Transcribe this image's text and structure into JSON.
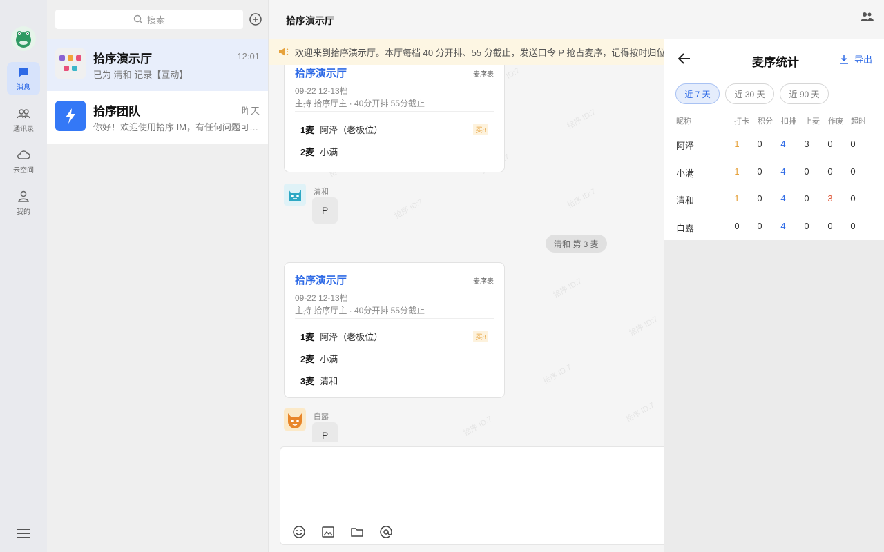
{
  "nav": {
    "items": [
      {
        "label": "消息",
        "icon": "chat-icon",
        "active": true
      },
      {
        "label": "通讯录",
        "icon": "contacts-icon",
        "active": false
      },
      {
        "label": "云空间",
        "icon": "cloud-icon",
        "active": false
      },
      {
        "label": "我的",
        "icon": "user-icon",
        "active": false
      }
    ]
  },
  "search": {
    "placeholder": "搜索"
  },
  "conversations": [
    {
      "name": "拾序演示厅",
      "time": "12:01",
      "preview": "已为 清和 记录【互动】",
      "active": true
    },
    {
      "name": "拾序团队",
      "time": "昨天",
      "preview": "你好！欢迎使用拾序 IM，有任何问题可随时联系我们",
      "active": false
    }
  ],
  "chat": {
    "title": "拾序演示厅",
    "notice": "欢迎来到拾序演示厅。本厅每档 40 分开排、55 分截止，发送口令 P 抢占麦序，记得按时归位。",
    "card1": {
      "title": "拾序演示厅",
      "tag": "麦序表",
      "date": "09-22 12-13档",
      "host": "主持 拾序厅主 · 40分开排 55分截止",
      "rows": [
        {
          "slot": "1麦",
          "name": "阿泽（老板位）",
          "badge": "买8"
        },
        {
          "slot": "2麦",
          "name": "小满"
        }
      ]
    },
    "msg1": {
      "sender": "清和",
      "text": "P"
    },
    "system": "清和 第 3 麦",
    "card2": {
      "title": "拾序演示厅",
      "tag": "麦序表",
      "date": "09-22 12-13档",
      "host": "主持 拾序厅主 · 40分开排 55分截止",
      "rows": [
        {
          "slot": "1麦",
          "name": "阿泽（老板位）",
          "badge": "买8"
        },
        {
          "slot": "2麦",
          "name": "小满"
        },
        {
          "slot": "3麦",
          "name": "清和"
        }
      ]
    },
    "msg2": {
      "sender": "白露",
      "text": "P"
    },
    "watermark": "拾序 ID:7",
    "tools": [
      "emoji-icon",
      "image-icon",
      "folder-icon",
      "mention-icon"
    ]
  },
  "stats": {
    "title": "麦序统计",
    "export_label": "导出",
    "ranges": [
      "近 7 天",
      "近 30 天",
      "近 90 天"
    ],
    "active_range": "近 7 天",
    "headers": [
      "昵称",
      "打卡",
      "积分",
      "扣排",
      "上麦",
      "作废",
      "超时"
    ],
    "rows": [
      {
        "name": "阿泽",
        "values": [
          "1",
          "0",
          "4",
          "3",
          "0",
          "0"
        ]
      },
      {
        "name": "小满",
        "values": [
          "1",
          "0",
          "4",
          "0",
          "0",
          "0"
        ]
      },
      {
        "name": "清和",
        "values": [
          "1",
          "0",
          "4",
          "0",
          "3",
          "0"
        ]
      },
      {
        "name": "白露",
        "values": [
          "0",
          "0",
          "4",
          "0",
          "0",
          "0"
        ]
      }
    ]
  },
  "colors": {
    "accent": "#2e6ae6",
    "highlight": "#e6a23c",
    "alert": "#e05a3b",
    "notice_bg": "#fdf6e3"
  }
}
